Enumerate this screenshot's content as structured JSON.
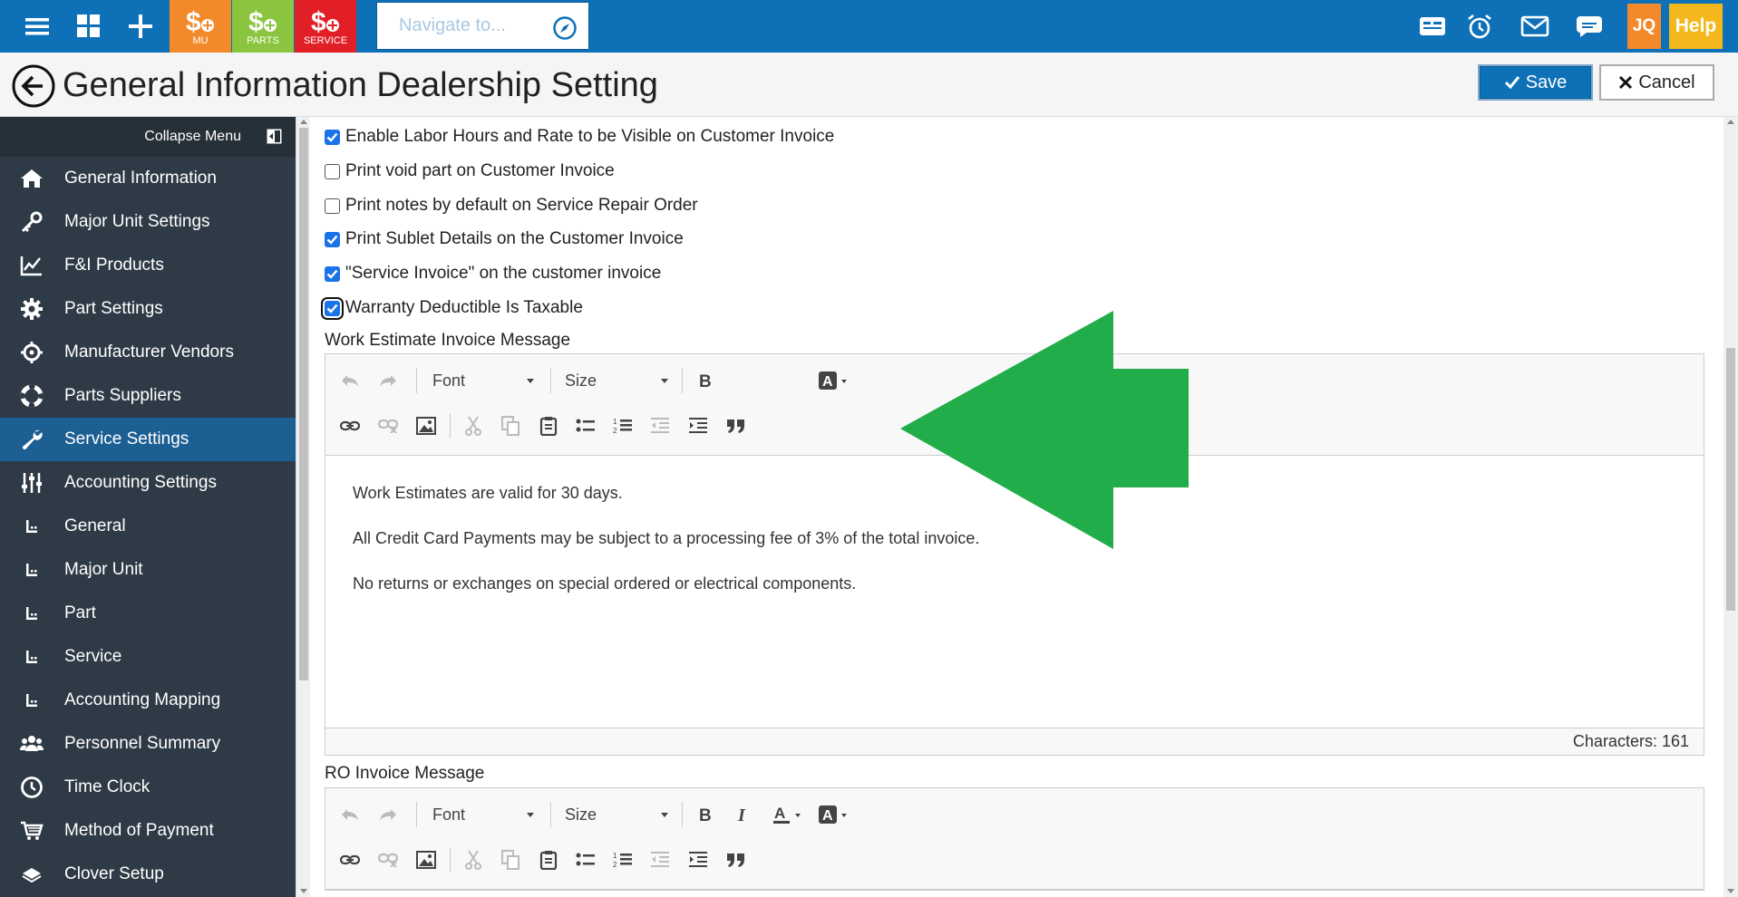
{
  "topbar": {
    "tiles": [
      {
        "label": "MU",
        "color": "#f28a2c"
      },
      {
        "label": "PARTS",
        "color": "#8bc53f"
      },
      {
        "label": "SERVICE",
        "color": "#e21f26"
      }
    ],
    "navigate_placeholder": "Navigate to...",
    "user_initials": "JQ",
    "help_label": "Help"
  },
  "header": {
    "title": "General Information Dealership Setting",
    "save_label": "Save",
    "cancel_label": "Cancel"
  },
  "sidebar": {
    "collapse_label": "Collapse Menu",
    "items": [
      {
        "label": "General Information",
        "icon": "home-icon"
      },
      {
        "label": "Major Unit Settings",
        "icon": "key-icon"
      },
      {
        "label": "F&I Products",
        "icon": "line-chart-icon"
      },
      {
        "label": "Part Settings",
        "icon": "gear-icon"
      },
      {
        "label": "Manufacturer Vendors",
        "icon": "crosshair-icon"
      },
      {
        "label": "Parts Suppliers",
        "icon": "lifebuoy-icon"
      },
      {
        "label": "Service Settings",
        "icon": "wrench-icon",
        "active": true
      },
      {
        "label": "Accounting Settings",
        "icon": "sliders-icon"
      },
      {
        "label": "General",
        "icon": "sub-item-icon"
      },
      {
        "label": "Major Unit",
        "icon": "sub-item-icon"
      },
      {
        "label": "Part",
        "icon": "sub-item-icon"
      },
      {
        "label": "Service",
        "icon": "sub-item-icon"
      },
      {
        "label": "Accounting Mapping",
        "icon": "sub-item-icon"
      },
      {
        "label": "Personnel Summary",
        "icon": "users-icon"
      },
      {
        "label": "Time Clock",
        "icon": "clock-icon"
      },
      {
        "label": "Method of Payment",
        "icon": "cart-icon"
      },
      {
        "label": "Clover Setup",
        "icon": "card-icon"
      }
    ]
  },
  "options": [
    {
      "label": "Enable Labor Hours and Rate to be Visible on Customer Invoice",
      "checked": true
    },
    {
      "label": "Print void part on Customer Invoice",
      "checked": false
    },
    {
      "label": "Print notes by default on Service Repair Order",
      "checked": false
    },
    {
      "label": "Print Sublet Details on the Customer Invoice",
      "checked": true
    },
    {
      "label": "\"Service Invoice\" on the customer invoice",
      "checked": true
    },
    {
      "label": "Warranty Deductible Is Taxable",
      "checked": true,
      "focused": true
    }
  ],
  "work_estimate": {
    "label": "Work Estimate Invoice Message",
    "font_label": "Font",
    "size_label": "Size",
    "paragraphs": [
      "Work Estimates are valid for 30 days.",
      "All Credit Card Payments may be subject to a processing fee of 3% of the total invoice.",
      "No returns or exchanges on special ordered or electrical components."
    ],
    "char_count": "Characters: 161"
  },
  "ro_invoice": {
    "label": "RO Invoice Message",
    "font_label": "Font",
    "size_label": "Size"
  },
  "colors": {
    "topbar": "#0e71b8",
    "sidebar": "#2e3a46",
    "sidebar_active": "#1b5f93",
    "arrow": "#22ad4b"
  }
}
